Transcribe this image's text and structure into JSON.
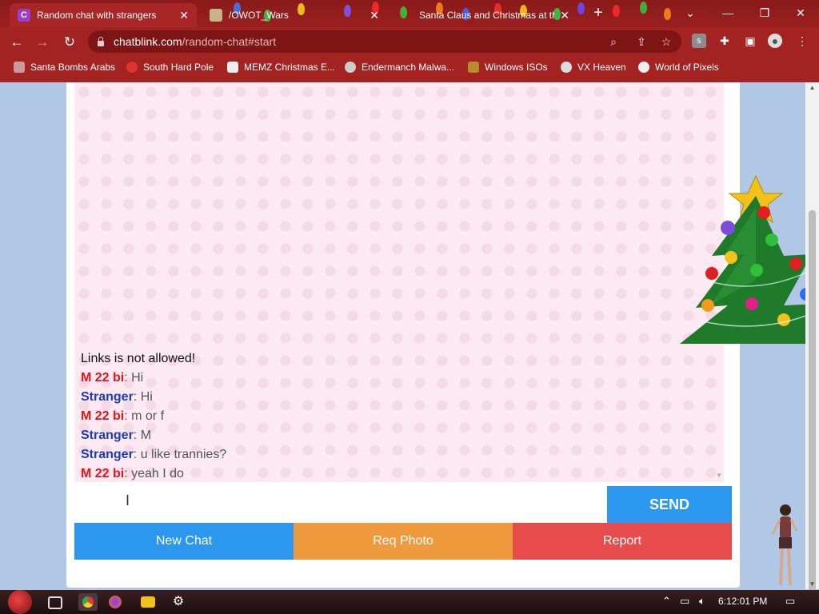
{
  "browser": {
    "tabs": [
      {
        "title": "Random chat with strangers",
        "favicon": "C",
        "active": true
      },
      {
        "title": "/OWOT_Wars",
        "favicon": "",
        "active": false
      },
      {
        "title": "Santa Claus and Christmas at the",
        "favicon": "",
        "active": false
      }
    ],
    "url": {
      "host": "chatblink.com",
      "path": "/random-chat#start"
    },
    "bookmarks": [
      {
        "label": "Santa Bombs Arabs",
        "icon": "figure-icon"
      },
      {
        "label": "South Hard Pole",
        "icon": "snowflake-icon"
      },
      {
        "label": "MEMZ Christmas E...",
        "icon": "window-icon"
      },
      {
        "label": "Endermanch Malwa...",
        "icon": "panda-icon"
      },
      {
        "label": "Windows ISOs",
        "icon": "person-icon"
      },
      {
        "label": "VX Heaven",
        "icon": "skull-icon"
      },
      {
        "label": "World of Pixels",
        "icon": "globe-icon"
      }
    ]
  },
  "chat": {
    "system_notice": "Links is not allowed!",
    "messages": [
      {
        "sender": "M 22 bi",
        "role": "me",
        "text": ": Hi"
      },
      {
        "sender": "Stranger",
        "role": "stranger",
        "text": ": Hi"
      },
      {
        "sender": "M 22 bi",
        "role": "me",
        "text": ": m or f"
      },
      {
        "sender": "Stranger",
        "role": "stranger",
        "text": ": M"
      },
      {
        "sender": "Stranger",
        "role": "stranger",
        "text": ": u like trannies?"
      },
      {
        "sender": "M 22 bi",
        "role": "me",
        "text": ": yeah I do"
      }
    ],
    "input_value": "",
    "send_label": "SEND",
    "actions": [
      {
        "label": "New Chat",
        "color": "#2b97ee"
      },
      {
        "label": "Req Photo",
        "color": "#f09a3e"
      },
      {
        "label": "Report",
        "color": "#e84b4b"
      }
    ]
  },
  "taskbar": {
    "time": "6:12:01 PM"
  },
  "colors": {
    "me_nick": "#e0141b",
    "stranger_nick": "#1e3bb3",
    "send": "#2b97ee"
  }
}
